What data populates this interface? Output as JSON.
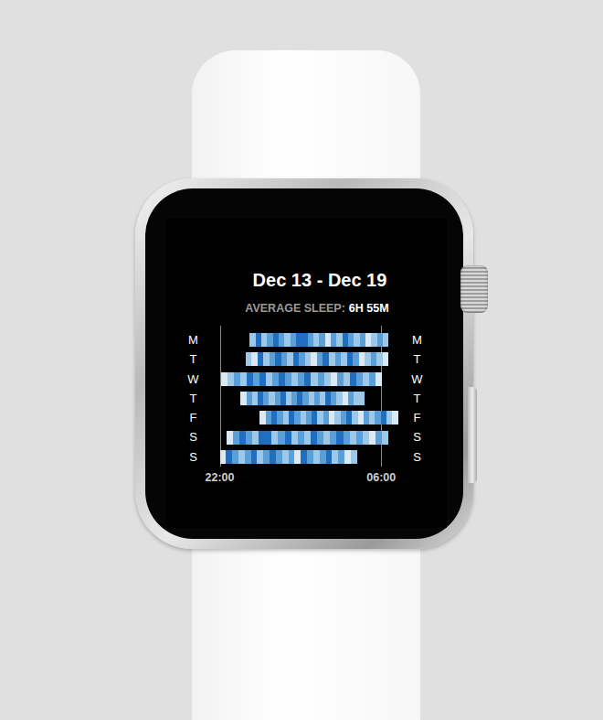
{
  "title": "Dec 13 - Dec 19",
  "summary": {
    "label": "AVERAGE SLEEP:",
    "value": "6H 55M"
  },
  "chart": {
    "ticks": [
      {
        "label": "22:00",
        "hour": 0
      },
      {
        "label": "06:00",
        "hour": 8
      }
    ],
    "rows": [
      {
        "day": "M",
        "start": 1.49,
        "end": 8.37,
        "depth": [
          1,
          3,
          1,
          2,
          3,
          2,
          1,
          2,
          3,
          3,
          2,
          1,
          2,
          0,
          2,
          1,
          3,
          2,
          1,
          2,
          0,
          1,
          2,
          1
        ]
      },
      {
        "day": "T",
        "start": 1.27,
        "end": 8.37,
        "depth": [
          1,
          0,
          3,
          1,
          2,
          3,
          2,
          1,
          3,
          2,
          1,
          0,
          2,
          3,
          1,
          2,
          1,
          3,
          2,
          0,
          1,
          2,
          1,
          0
        ]
      },
      {
        "day": "W",
        "start": 0.08,
        "end": 8.01,
        "depth": [
          0,
          1,
          2,
          1,
          3,
          2,
          3,
          1,
          2,
          3,
          2,
          1,
          2,
          3,
          1,
          2,
          1,
          0,
          2,
          1,
          3,
          2,
          1,
          2,
          0
        ]
      },
      {
        "day": "T",
        "start": 1.04,
        "end": 7.19,
        "depth": [
          0,
          2,
          1,
          3,
          2,
          1,
          2,
          3,
          1,
          2,
          3,
          2,
          1,
          2,
          1,
          3,
          2,
          1,
          0,
          2,
          1,
          1
        ]
      },
      {
        "day": "F",
        "start": 1.99,
        "end": 8.82,
        "depth": [
          0,
          2,
          3,
          2,
          1,
          3,
          2,
          1,
          2,
          3,
          1,
          2,
          0,
          1,
          2,
          3,
          1,
          0,
          2,
          1,
          2,
          3,
          1,
          0
        ]
      },
      {
        "day": "S",
        "start": 0.32,
        "end": 8.37,
        "depth": [
          0,
          2,
          3,
          2,
          1,
          3,
          3,
          1,
          2,
          3,
          1,
          2,
          1,
          3,
          2,
          1,
          2,
          3,
          2,
          1,
          2,
          1,
          0,
          2,
          1
        ]
      },
      {
        "day": "S",
        "start": 0.0,
        "end": 6.79,
        "depth": [
          0,
          3,
          2,
          1,
          2,
          3,
          1,
          2,
          3,
          2,
          1,
          2,
          0,
          3,
          2,
          1,
          2,
          3,
          1,
          2,
          0,
          1
        ]
      }
    ]
  }
}
